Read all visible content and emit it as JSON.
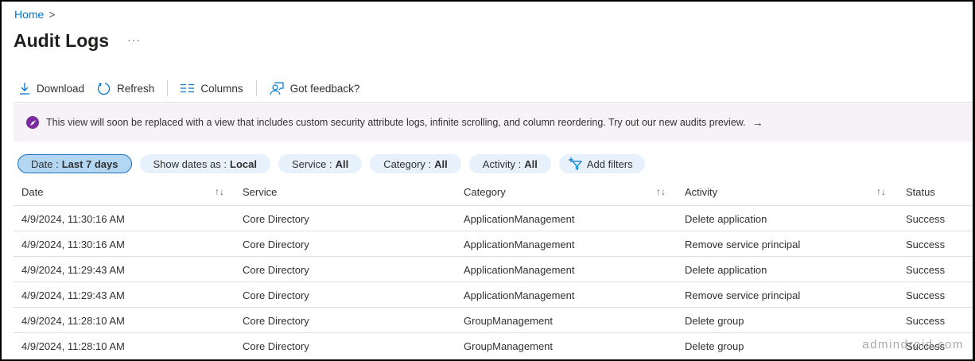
{
  "breadcrumb": {
    "home": "Home",
    "chevron": ">"
  },
  "page_title": "Audit Logs",
  "more": "···",
  "toolbar": {
    "download": "Download",
    "refresh": "Refresh",
    "columns": "Columns",
    "feedback": "Got feedback?"
  },
  "banner": {
    "text": "This view will soon be replaced with a view that includes custom security attribute logs, infinite scrolling, and column reordering. Try out our new audits preview.",
    "arrow": "→"
  },
  "filters": [
    {
      "label": "Date :",
      "value": "Last 7 days"
    },
    {
      "label": "Show dates as :",
      "value": "Local"
    },
    {
      "label": "Service :",
      "value": "All"
    },
    {
      "label": "Category :",
      "value": "All"
    },
    {
      "label": "Activity :",
      "value": "All"
    }
  ],
  "add_filters": "Add filters",
  "table": {
    "headers": [
      "Date",
      "Service",
      "Category",
      "Activity",
      "Status"
    ],
    "sort_icon": "↑↓",
    "rows": [
      [
        "4/9/2024, 11:30:16 AM",
        "Core Directory",
        "ApplicationManagement",
        "Delete application",
        "Success"
      ],
      [
        "4/9/2024, 11:30:16 AM",
        "Core Directory",
        "ApplicationManagement",
        "Remove service principal",
        "Success"
      ],
      [
        "4/9/2024, 11:29:43 AM",
        "Core Directory",
        "ApplicationManagement",
        "Delete application",
        "Success"
      ],
      [
        "4/9/2024, 11:29:43 AM",
        "Core Directory",
        "ApplicationManagement",
        "Remove service principal",
        "Success"
      ],
      [
        "4/9/2024, 11:28:10 AM",
        "Core Directory",
        "GroupManagement",
        "Delete group",
        "Success"
      ],
      [
        "4/9/2024, 11:28:10 AM",
        "Core Directory",
        "GroupManagement",
        "Delete group",
        "Success"
      ]
    ]
  },
  "watermark": "admindroid.com",
  "colors": {
    "accent": "#0078d4",
    "banner_bg": "#f6f2f8",
    "rocket": "#7a2c9e",
    "pill": "#e6f1fb",
    "pill_active": "#b3d6f2"
  }
}
